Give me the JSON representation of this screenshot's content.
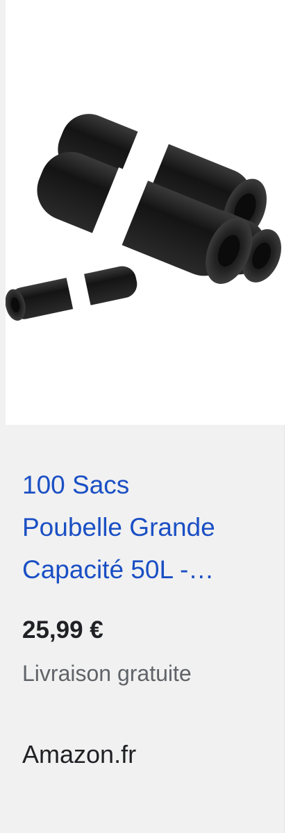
{
  "product": {
    "image_icon": "trash-bag-rolls-image",
    "title_lines": [
      "100 Sacs",
      "Poubelle Grande",
      "Capacité 50L -…"
    ],
    "price": "25,99 €",
    "shipping": "Livraison gratuite",
    "merchant": "Amazon.fr"
  },
  "colors": {
    "card_background": "#f1f1f1",
    "title_link": "#1a4fc4",
    "price_text": "#202124",
    "shipping_text": "#5f6368",
    "bag_black": "#1c1c1c",
    "band_white": "#ffffff"
  }
}
